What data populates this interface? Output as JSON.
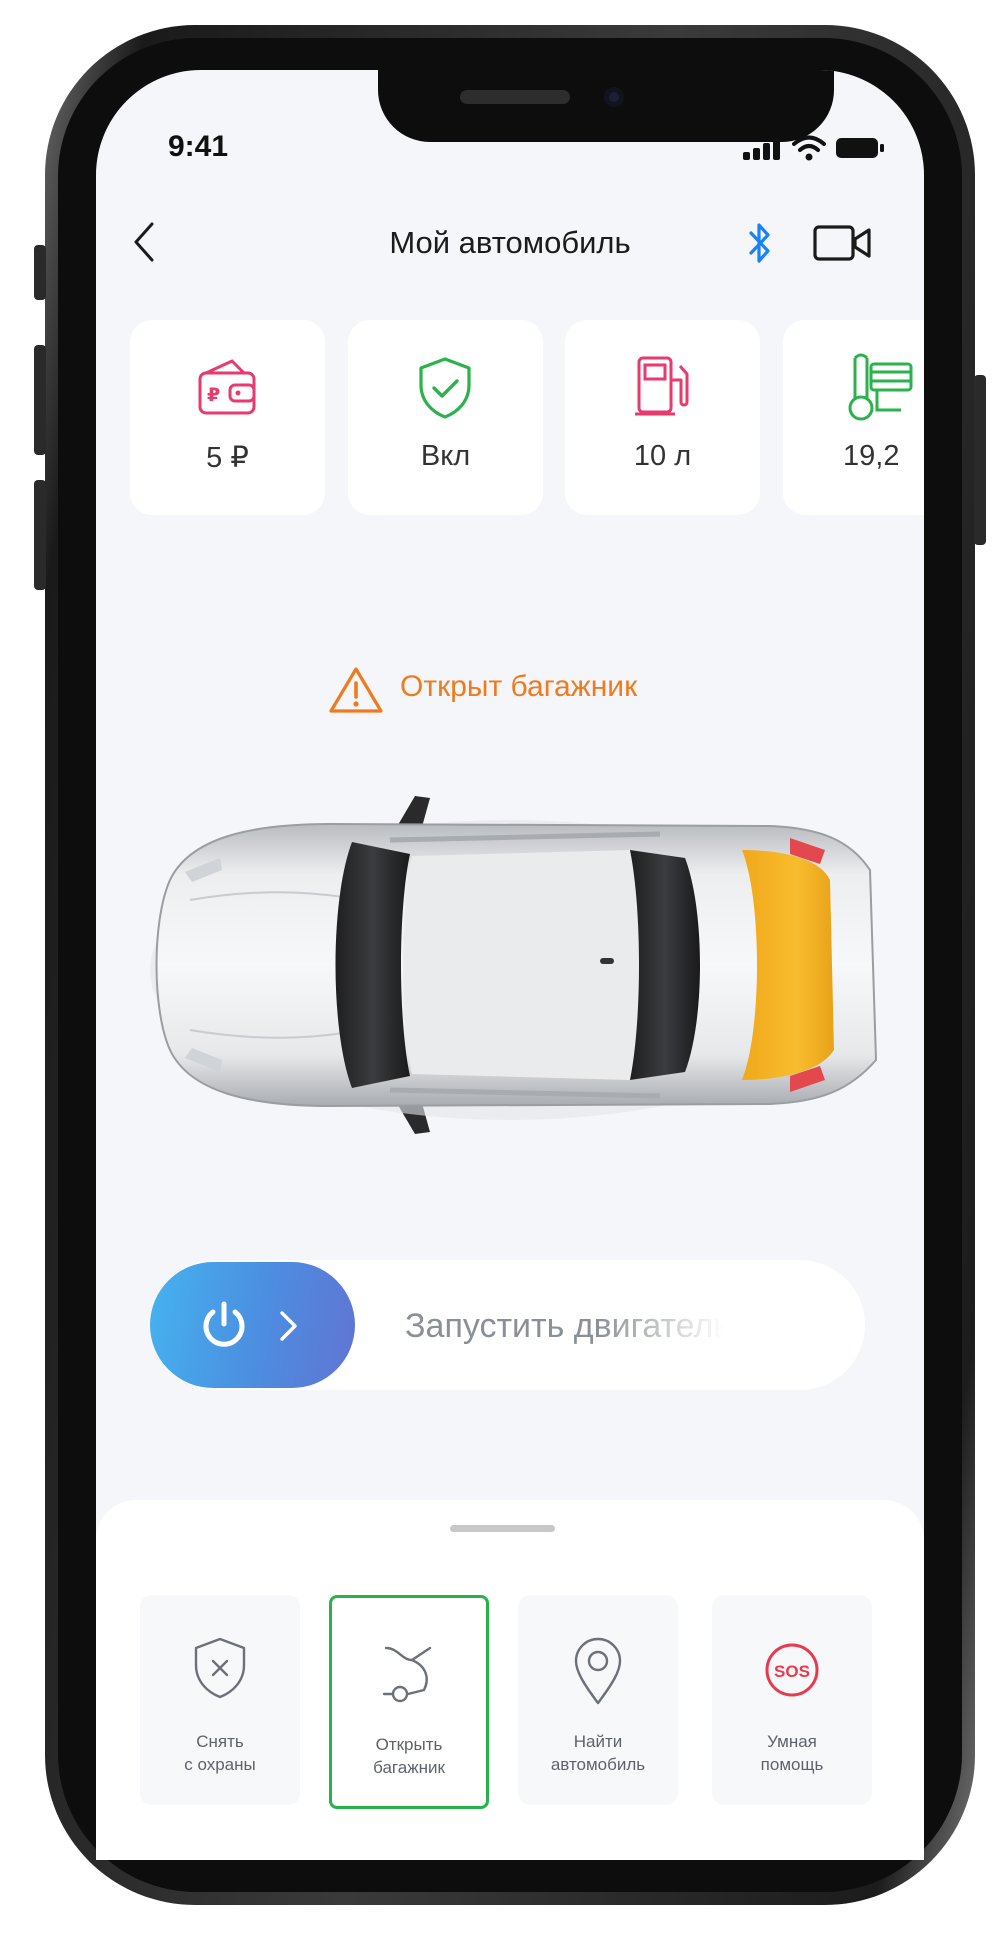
{
  "status_bar": {
    "time": "9:41"
  },
  "header": {
    "title": "Мой автомобиль"
  },
  "stat_cards": [
    {
      "value": "5 ₽",
      "icon": "wallet-icon",
      "color": "#e83a6c"
    },
    {
      "value": "Вкл",
      "icon": "shield-check-icon",
      "color": "#2bb24c"
    },
    {
      "value": "10 л",
      "icon": "fuel-icon",
      "color": "#e83a6c"
    },
    {
      "value": "19,2",
      "icon": "engine-temperature-icon",
      "color": "#2bb24c"
    }
  ],
  "alert": {
    "text": "Открыт багажник",
    "color": "#f07b1f"
  },
  "start_slider": {
    "label": "Запустить двигатель"
  },
  "actions": [
    {
      "label_line1": "Снять",
      "label_line2": "с охраны",
      "icon": "shield-x-icon"
    },
    {
      "label_line1": "Открыть",
      "label_line2": "багажник",
      "icon": "trunk-icon",
      "active": true
    },
    {
      "label_line1": "Найти",
      "label_line2": "автомобиль",
      "icon": "location-pin-icon"
    },
    {
      "label_line1": "Умная",
      "label_line2": "помощь",
      "icon": "sos-icon"
    }
  ],
  "colors": {
    "accent_green": "#27b24b",
    "bluetooth_blue": "#1a82f7",
    "warning_orange": "#f07b1f"
  }
}
